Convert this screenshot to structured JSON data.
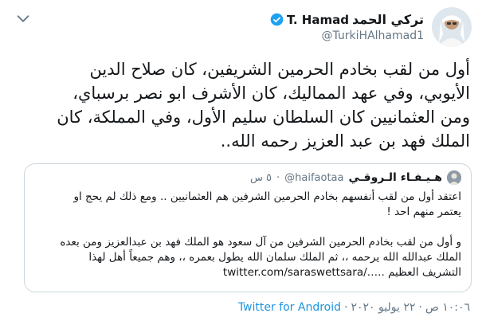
{
  "author": {
    "name_ar": "تركي الحمد",
    "name_en": "T. Hamad",
    "handle": "@TurkiHAlhamad1"
  },
  "tweet": {
    "text": "أول من لقب بخادم الحرمين الشريفين، كان صلاح الدين\nالأيوبي، وفي عهد المماليك، كان الأشرف ابو نصر برسباي،\nومن العثمانيين كان السلطان سليم الأول، وفي المملكة، كان\nالملك فهد بن عبد العزيز رحمه الله.."
  },
  "quote": {
    "name": "هـيـفـاء الـروقـي",
    "handle": "@haifaotaa",
    "dot": "·",
    "time": "٥ س",
    "para1": "اعتقد أول من لقب أنفسهم بخادم الحرمين الشرفين هم العثمانيين .. ومع ذلك لم يحج او\nيعتمر منهم احد !",
    "para2": "و أول من لقب بخادم الحرمين الشرفين من آل سعود هو الملك فهد بن عبدالعزيز ومن بعده\nالملك عبدالله الله يرحمه ،، ثم الملك سلمان الله يطول بعمره ،، وهم جميعاً أهل لهذا\nالتشريف العظيم ..",
    "link": "twitter.com/saraswettsara/…"
  },
  "meta": {
    "time": "١٠:٠٦ ص",
    "sep1": "·",
    "date": "٢٢ يوليو ٢٠٢٠",
    "sep2": "·",
    "source": "Twitter for Android"
  },
  "colors": {
    "verified": "#1da1f2",
    "link": "#1b95e0",
    "secondary_text": "#657786",
    "border": "#ccd6dd"
  },
  "icons": {
    "chevron": "chevron-down-icon",
    "verified": "verified-badge-icon"
  }
}
